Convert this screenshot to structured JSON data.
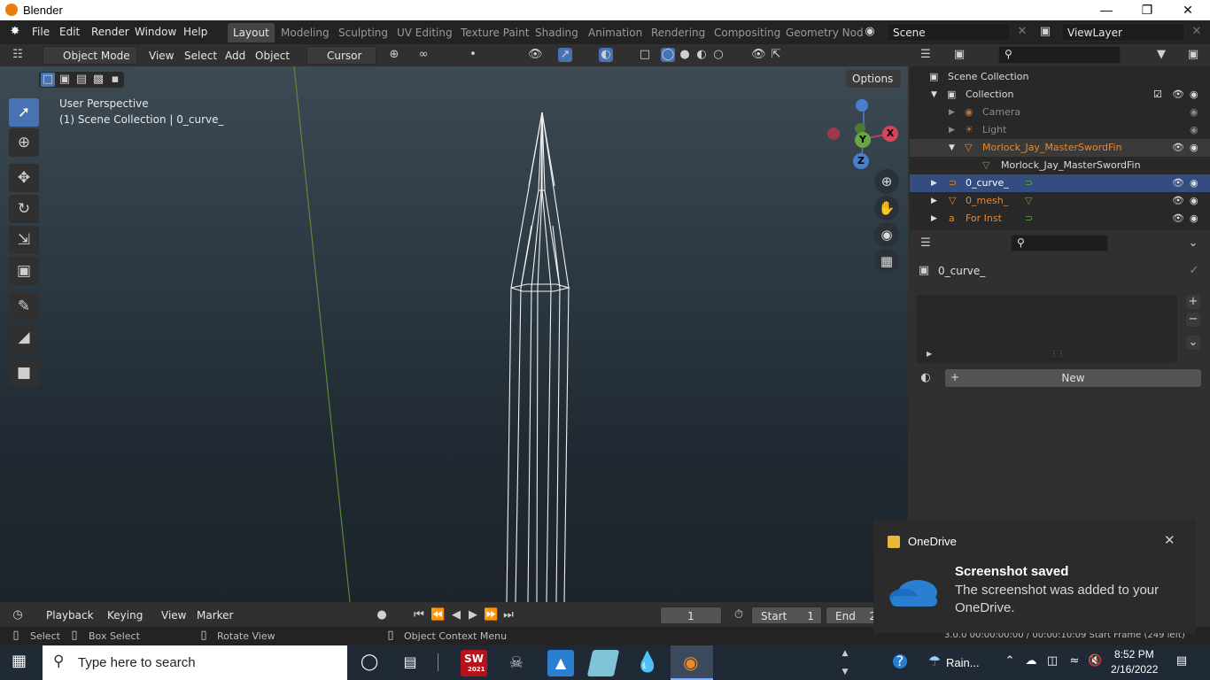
{
  "window": {
    "title": "Blender"
  },
  "topbar": {
    "menus": [
      "File",
      "Edit",
      "Render",
      "Window",
      "Help"
    ],
    "workspaces": [
      "Layout",
      "Modeling",
      "Sculpting",
      "UV Editing",
      "Texture Paint",
      "Shading",
      "Animation",
      "Rendering",
      "Compositing",
      "Geometry Nod"
    ],
    "scene": "Scene",
    "view_layer": "ViewLayer"
  },
  "vpheader": {
    "mode": "Object Mode",
    "menus": [
      "View",
      "Select",
      "Add",
      "Object"
    ],
    "pivot": "Cursor"
  },
  "viewport": {
    "perspective": "User Perspective",
    "context": "(1) Scene Collection | 0_curve_",
    "options": "Options",
    "gizmo": {
      "x": "X",
      "y": "Y",
      "z": "Z"
    }
  },
  "outliner": {
    "scene_collection": "Scene Collection",
    "collection": "Collection",
    "items": [
      {
        "label": "Camera",
        "style": "dim"
      },
      {
        "label": "Light",
        "style": "dim"
      },
      {
        "label": "Morlock_Jay_MasterSwordFin",
        "style": "orange"
      },
      {
        "label": "Morlock_Jay_MasterSwordFin",
        "style": "child"
      },
      {
        "label": "0_curve_",
        "style": "selected"
      },
      {
        "label": "0_mesh_",
        "style": "orange"
      },
      {
        "label": "For Inst",
        "style": "orange"
      }
    ]
  },
  "properties": {
    "object": "0_curve_",
    "new_button": "New"
  },
  "timeline": {
    "menus": [
      "Playback",
      "Keying",
      "View",
      "Marker"
    ],
    "frame": "1",
    "start_label": "Start",
    "start": "1",
    "end_label": "End",
    "end": "2"
  },
  "status": {
    "select": "Select",
    "box_select": "Box Select",
    "rotate": "Rotate View",
    "context_menu": "Object Context Menu",
    "info": "3.0.0  00:00:00:00 / 00:00:10:09  Start Frame (249 left)"
  },
  "taskbar": {
    "search_placeholder": "Type here to search",
    "weather": "Rain...",
    "time": "8:52 PM",
    "date": "2/16/2022",
    "sw_year": "2021"
  },
  "toast": {
    "app": "OneDrive",
    "title": "Screenshot saved",
    "body": "The screenshot was added to your OneDrive."
  },
  "colors": {
    "accent": "#4772b3",
    "selected_row": "#334d80",
    "orange": "#e8882a"
  }
}
